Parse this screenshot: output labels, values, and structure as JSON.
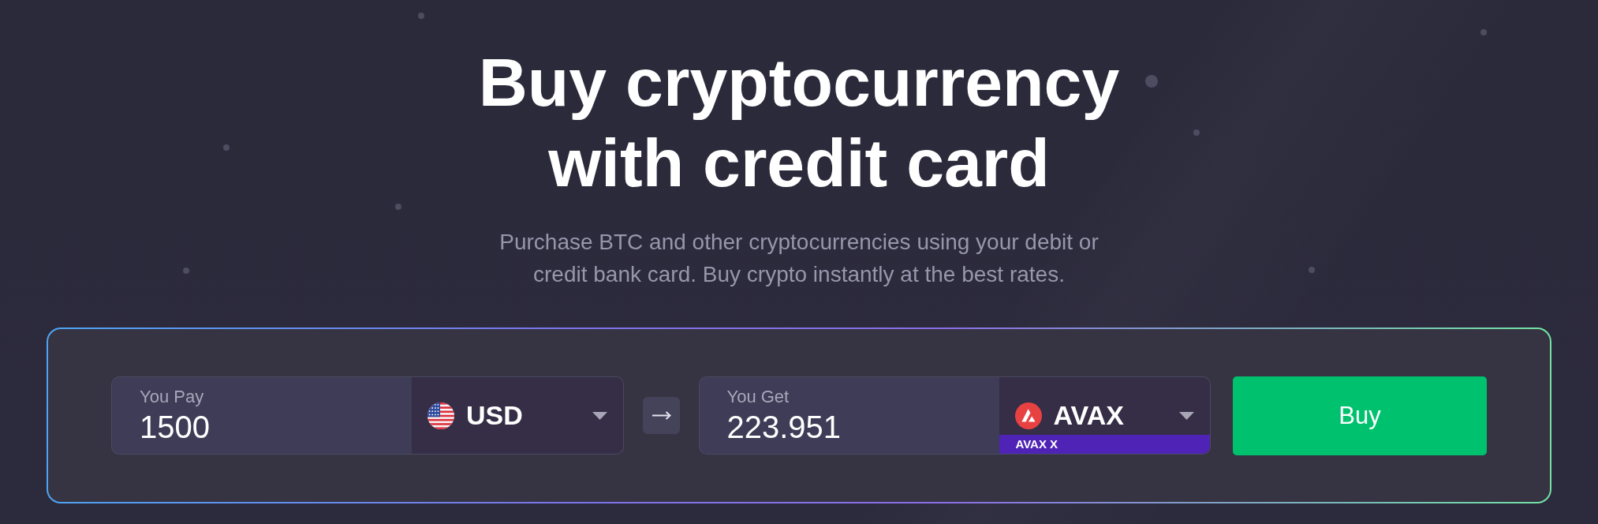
{
  "hero": {
    "title": "Buy cryptocurrency with credit card",
    "subtitle": "Purchase BTC and other cryptocurrencies using your debit or credit bank card. Buy crypto instantly at the best rates."
  },
  "converter": {
    "fields": [
      {
        "label": "You Pay",
        "value": "1500",
        "currency": {
          "code": "USD",
          "kind": "flag"
        }
      },
      {
        "label": "You Get",
        "value": "223.951",
        "currency": {
          "code": "AVAX",
          "kind": "coin",
          "network": "AVAX X"
        }
      }
    ],
    "buy_button": "Buy"
  }
}
